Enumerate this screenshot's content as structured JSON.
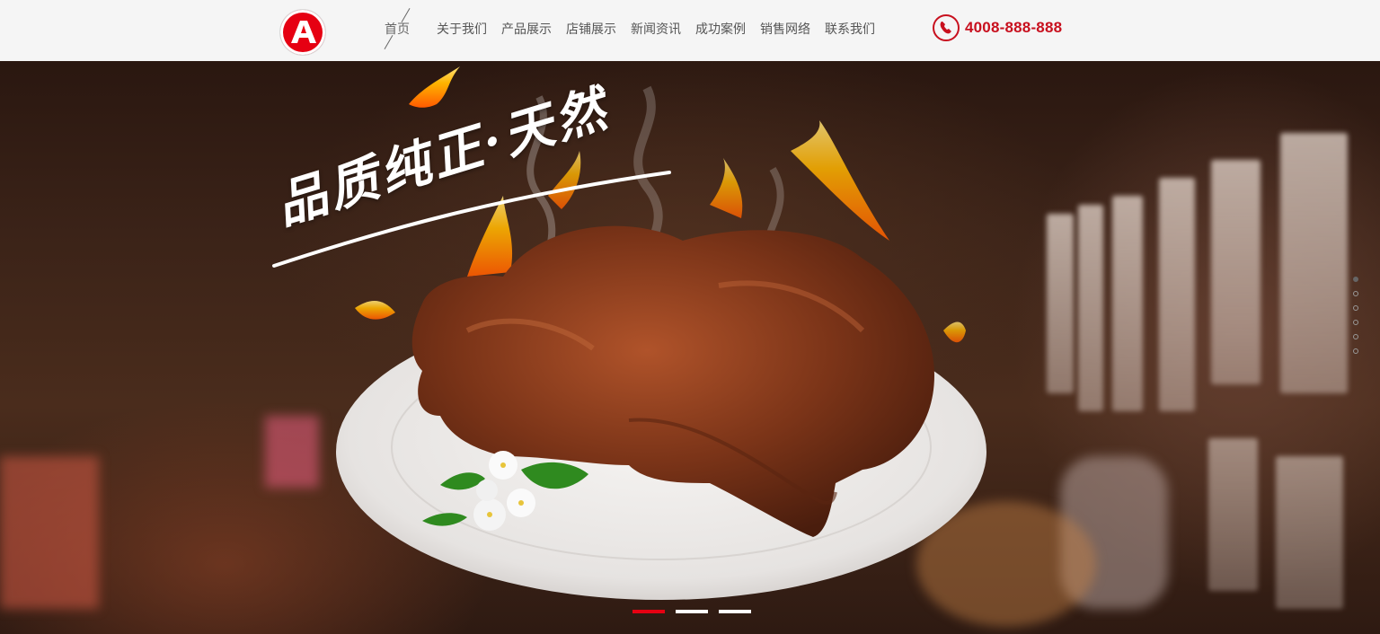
{
  "header": {
    "logo_letter": "A",
    "nav": [
      {
        "label": "首页",
        "active": true
      },
      {
        "label": "关于我们"
      },
      {
        "label": "产品展示"
      },
      {
        "label": "店铺展示"
      },
      {
        "label": "新闻资讯"
      },
      {
        "label": "成功案例"
      },
      {
        "label": "销售网络"
      },
      {
        "label": "联系我们"
      }
    ],
    "phone": "4008-888-888"
  },
  "banner": {
    "slogan": "品质纯正·天然",
    "slide_count": 3,
    "active_slide": 1,
    "side_dots": 6,
    "active_side_dot": 1
  },
  "colors": {
    "brand_red": "#e60012",
    "phone_red": "#c8101e",
    "header_bg": "#f5f5f5"
  }
}
